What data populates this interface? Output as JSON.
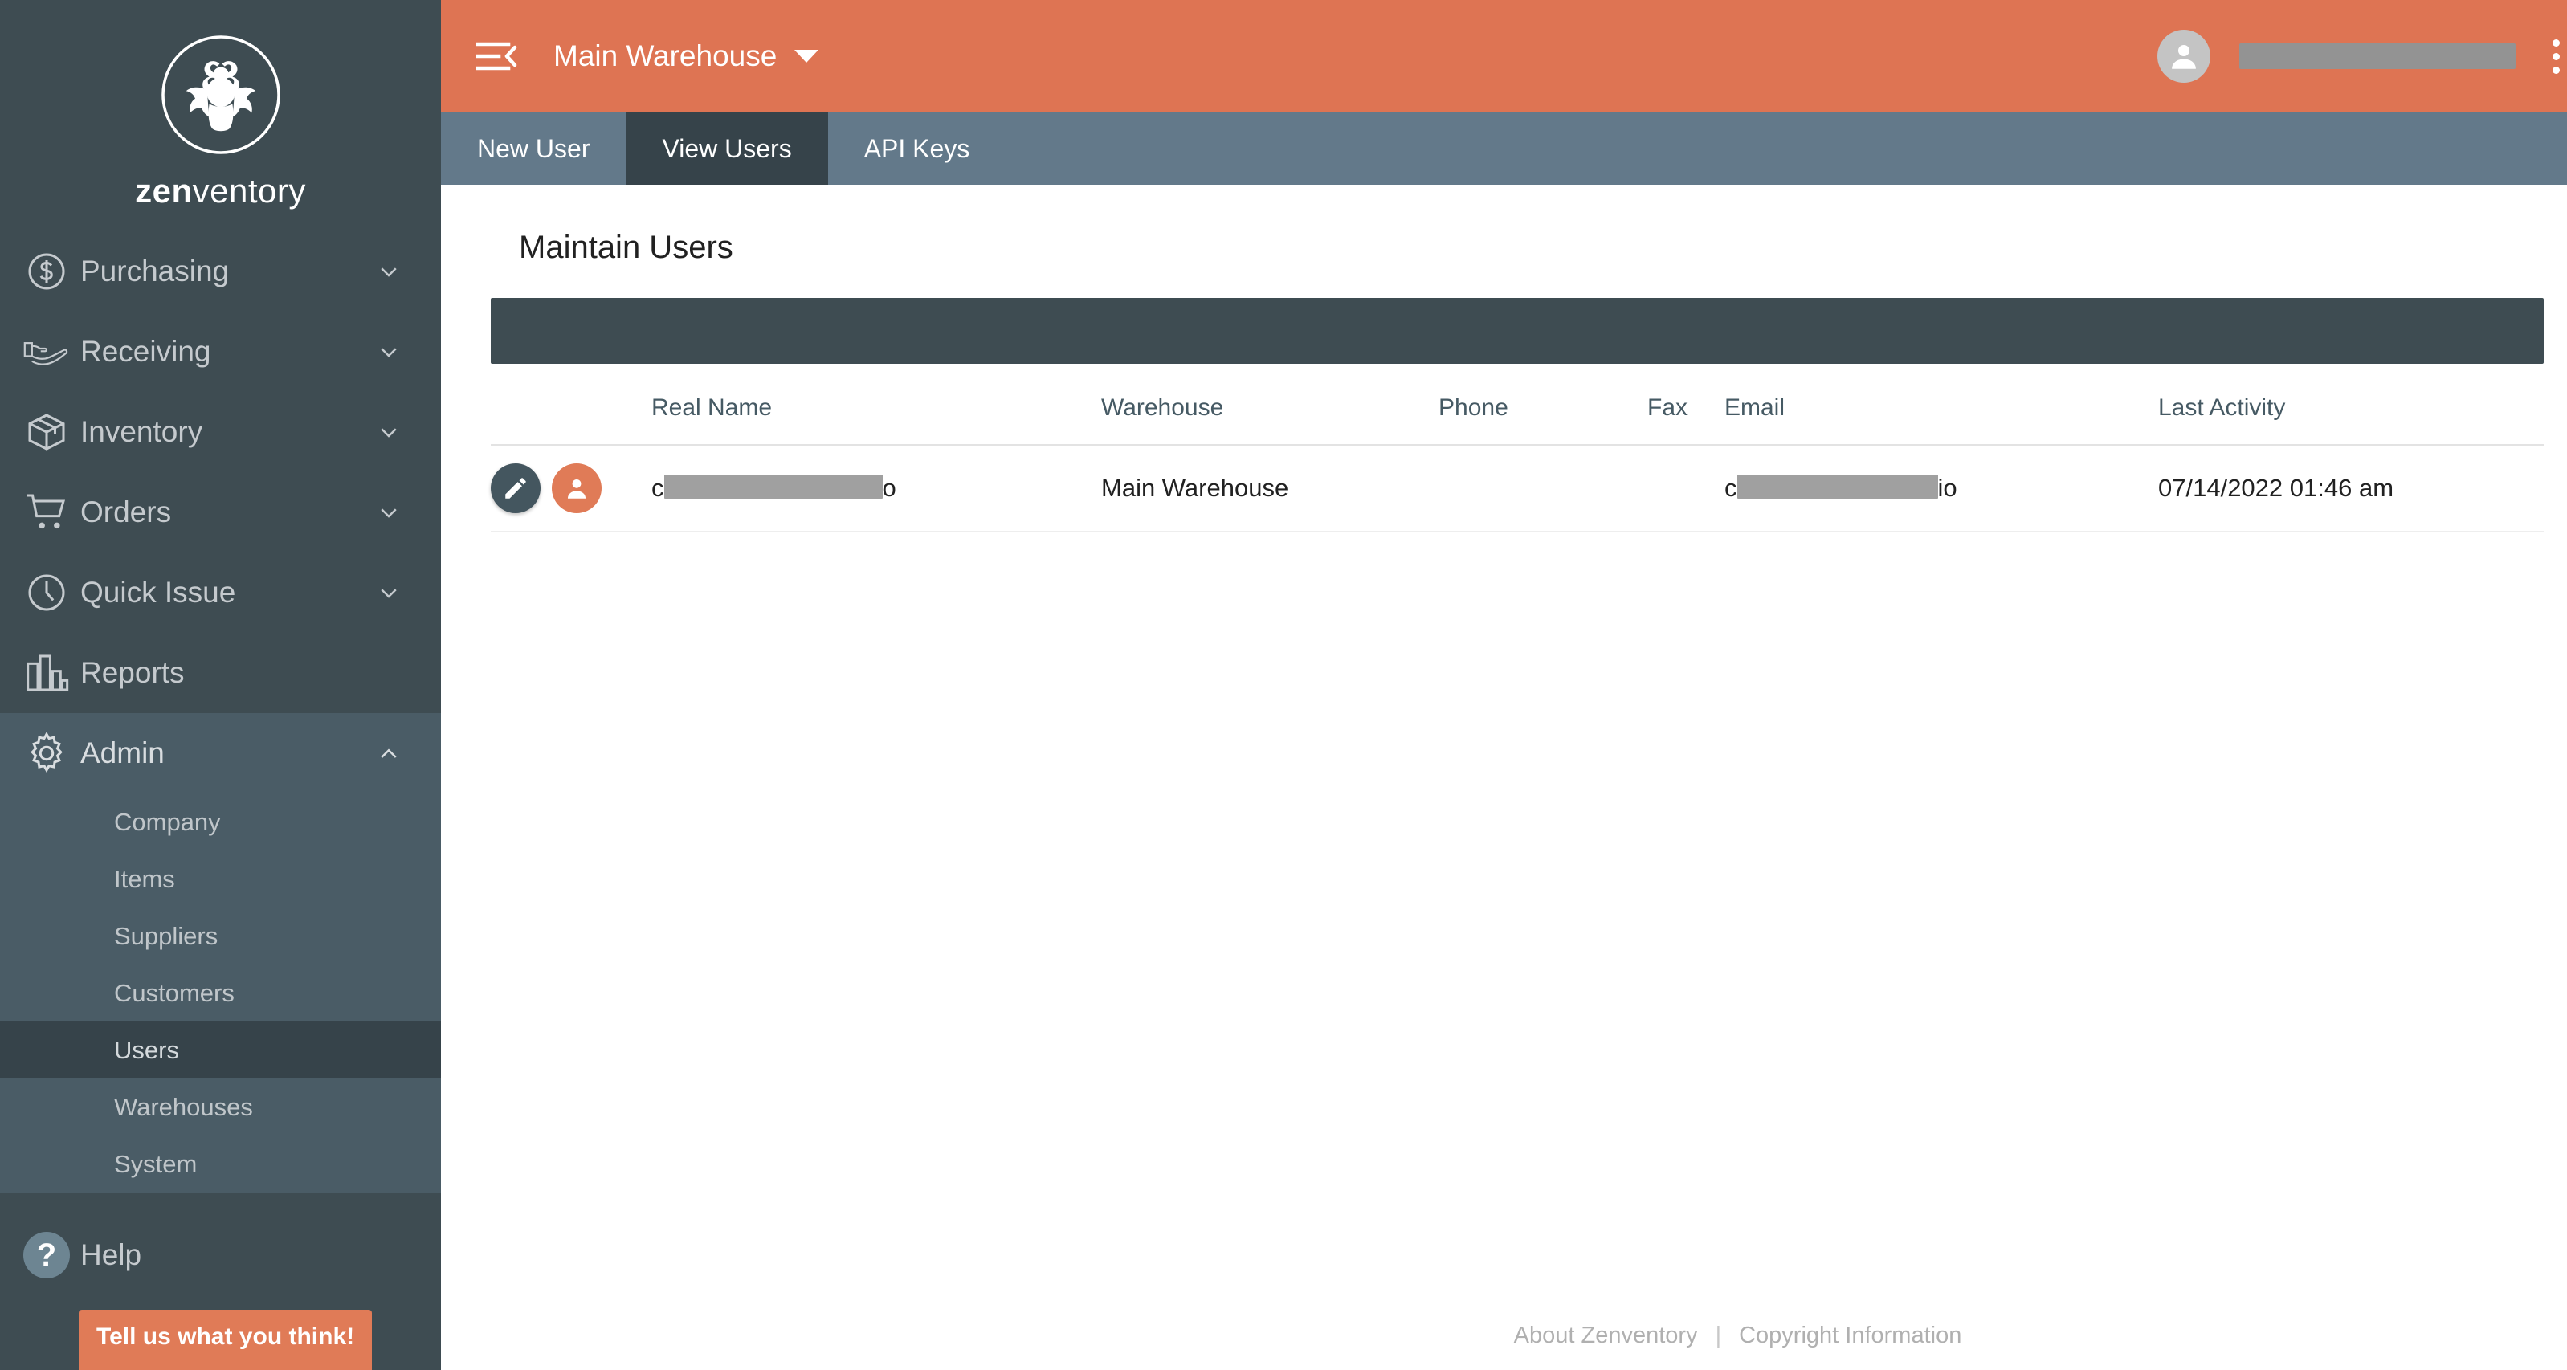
{
  "brand": {
    "name_light": "ventory",
    "name_bold": "zen",
    "logo_icon": "zenventory-bug-logo"
  },
  "colors": {
    "header_orange": "#de7453",
    "sidebar_dark": "#3e4c52",
    "sidebar_expanded": "#4a5c66",
    "tabbar_blue": "#63798a",
    "tab_active": "#36434a",
    "accent": "#e07b57"
  },
  "topbar": {
    "menu_icon": "menu-collapse-icon",
    "warehouse_selected": "Main Warehouse",
    "warehouse_caret_icon": "caret-down-icon",
    "avatar_icon": "user-avatar-icon",
    "user_name": "",
    "user_name_redacted": true,
    "overflow_icon": "kebab-menu-icon"
  },
  "tabs": [
    {
      "label": "New User",
      "active": false
    },
    {
      "label": "View Users",
      "active": true
    },
    {
      "label": "API Keys",
      "active": false
    }
  ],
  "sidebar": {
    "items": [
      {
        "label": "Purchasing",
        "icon": "dollar-circle-icon",
        "expandable": true,
        "expanded": false
      },
      {
        "label": "Receiving",
        "icon": "hand-package-icon",
        "expandable": true,
        "expanded": false
      },
      {
        "label": "Inventory",
        "icon": "box-icon",
        "expandable": true,
        "expanded": false
      },
      {
        "label": "Orders",
        "icon": "shopping-cart-icon",
        "expandable": true,
        "expanded": false
      },
      {
        "label": "Quick Issue",
        "icon": "clock-icon",
        "expandable": true,
        "expanded": false
      },
      {
        "label": "Reports",
        "icon": "bar-chart-icon",
        "expandable": false,
        "expanded": false
      },
      {
        "label": "Admin",
        "icon": "gear-icon",
        "expandable": true,
        "expanded": true
      }
    ],
    "admin_subitems": [
      {
        "label": "Company",
        "active": false
      },
      {
        "label": "Items",
        "active": false
      },
      {
        "label": "Suppliers",
        "active": false
      },
      {
        "label": "Customers",
        "active": false
      },
      {
        "label": "Users",
        "active": true
      },
      {
        "label": "Warehouses",
        "active": false
      },
      {
        "label": "System",
        "active": false
      }
    ],
    "help": {
      "label": "Help",
      "icon": "question-mark-icon",
      "badge": "?"
    },
    "feedback_button": "Tell us what you think!"
  },
  "content": {
    "page_title": "Maintain Users",
    "table": {
      "columns": [
        "",
        "Real Name",
        "Warehouse",
        "Phone",
        "Fax",
        "Email",
        "Last Activity"
      ],
      "rows": [
        {
          "edit_icon": "pencil-icon",
          "avatar_icon": "user-avatar-icon",
          "real_name_prefix": "c",
          "real_name_suffix": "o",
          "real_name_redacted": true,
          "warehouse": "Main Warehouse",
          "phone": "",
          "fax": "",
          "email_prefix": "c",
          "email_suffix": "io",
          "email_redacted": true,
          "last_activity": "07/14/2022 01:46 am"
        }
      ]
    }
  },
  "footer": {
    "about_link": "About Zenventory",
    "separator": "|",
    "copyright_link": "Copyright Information"
  }
}
